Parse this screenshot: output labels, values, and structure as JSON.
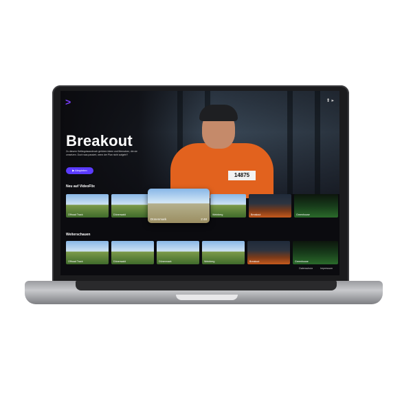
{
  "app": {
    "logo": ">",
    "top_icons": "⬆ ▸"
  },
  "hero": {
    "title": "Breakout",
    "description": "Zu diesem Gefängnisausbruch gehören Ideen und Menschen, die sie umsetzen. Doch was passiert, wenn der Plan nicht aufgeht?",
    "play_label": "▶ Abspielen",
    "badge_text": "14875"
  },
  "sections": {
    "new_label": "Neu auf VideoFlix",
    "continue_label": "Weiterschauen"
  },
  "rows": {
    "row1": [
      {
        "label": "Offroad Track",
        "style": "field"
      },
      {
        "label": "Dünenwald",
        "style": "field"
      },
      {
        "label": "",
        "style": "field"
      },
      {
        "label": "Weinberg",
        "style": "field"
      },
      {
        "label": "Breakout",
        "style": "dark"
      },
      {
        "label": "Greenhouse",
        "style": "green"
      }
    ],
    "featured": {
      "label": "Dünenmark",
      "duration": "2:48"
    },
    "row2": [
      {
        "label": "Offroad Track",
        "style": "field"
      },
      {
        "label": "Dünenwald",
        "style": "field"
      },
      {
        "label": "Dünenmark",
        "style": "field"
      },
      {
        "label": "Weinberg",
        "style": "field"
      },
      {
        "label": "Breakout",
        "style": "dark"
      },
      {
        "label": "Greenhouse",
        "style": "green"
      }
    ]
  },
  "footer": {
    "privacy": "Datenschutz",
    "imprint": "Impressum"
  },
  "colors": {
    "accent": "#5b3bff",
    "logo": "#7b3dff",
    "background": "#0b0b0f",
    "orange": "#e2621e"
  }
}
